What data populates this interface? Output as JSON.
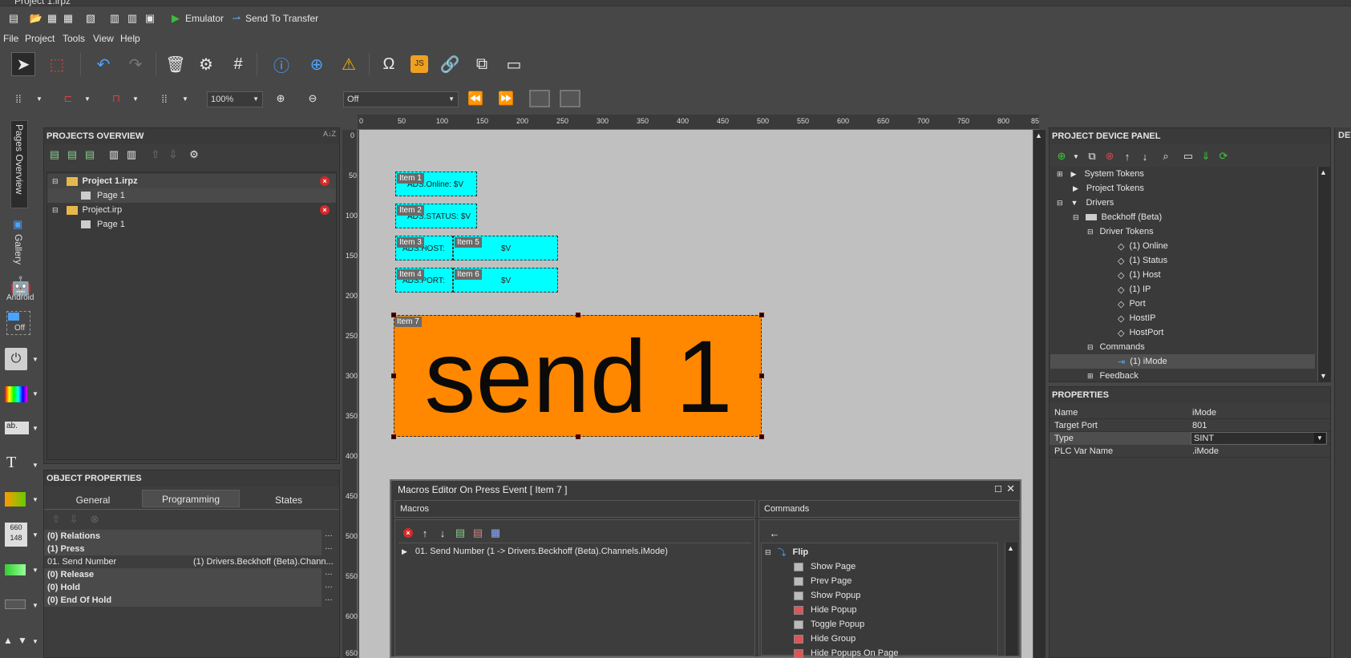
{
  "window": {
    "title": "Project 1.irpz"
  },
  "toolbar_top": {
    "emulator_label": "Emulator",
    "send_label": "Send To Transfer"
  },
  "menu": [
    "File",
    "Project",
    "Tools",
    "View",
    "Help"
  ],
  "toolbar_zoom": {
    "zoom": "100%",
    "layer": "Off"
  },
  "left_strip": {
    "pages_overview": "Pages Overview",
    "gallery": "Gallery",
    "android": "Android",
    "off": "Off"
  },
  "projects_overview": {
    "title": "PROJECTS OVERVIEW",
    "items": [
      {
        "label": "Project 1.irpz",
        "bold": true
      },
      {
        "label": "Page 1"
      },
      {
        "label": "Project.irp"
      },
      {
        "label": "Page 1"
      }
    ]
  },
  "object_properties": {
    "title": "OBJECT PROPERTIES",
    "tabs": [
      "General",
      "Programming",
      "States"
    ],
    "active_tab": "Programming",
    "rows": [
      {
        "label": "(0) Relations",
        "bold": true
      },
      {
        "label": "(1) Press",
        "bold": true
      },
      {
        "label": "01. Send Number",
        "value": "(1) Drivers.Beckhoff (Beta).Chann..."
      },
      {
        "label": "(0) Release",
        "bold": true
      },
      {
        "label": "(0) Hold",
        "bold": true
      },
      {
        "label": "(0) End Of Hold",
        "bold": true
      }
    ]
  },
  "ruler": {
    "h": [
      "0",
      "50",
      "100",
      "150",
      "200",
      "250",
      "300",
      "350",
      "400",
      "450",
      "500",
      "550",
      "600",
      "650",
      "700",
      "750",
      "800",
      "85"
    ],
    "v": [
      "0",
      "50",
      "100",
      "150",
      "200",
      "250",
      "300",
      "350",
      "400",
      "450",
      "500",
      "550",
      "600",
      "650"
    ]
  },
  "canvas": {
    "items": [
      {
        "tag": "Item 1",
        "text": "ADS.Online: $V"
      },
      {
        "tag": "Item 2",
        "text": "ADS.STATUS: $V"
      },
      {
        "tag": "Item 3",
        "text": "ADS.HOST:"
      },
      {
        "tag": "Item 5",
        "text": "$V"
      },
      {
        "tag": "Item 4",
        "text": "ADS.PORT:"
      },
      {
        "tag": "Item 6",
        "text": "$V"
      },
      {
        "tag": "Item 7",
        "text": "send 1"
      }
    ]
  },
  "macros_editor": {
    "title": "Macros Editor On Press Event [ Item 7 ]",
    "macros_header": "Macros",
    "commands_header": "Commands",
    "macro_rows": [
      "01. Send Number (1 -> Drivers.Beckhoff (Beta).Channels.iMode)"
    ],
    "commands_group": "Flip",
    "commands": [
      "Show Page",
      "Prev Page",
      "Show Popup",
      "Hide Popup",
      "Toggle Popup",
      "Hide Group",
      "Hide Popups On Page"
    ]
  },
  "device_panel": {
    "title": "PROJECT DEVICE PANEL",
    "tree": [
      {
        "label": "System Tokens",
        "level": 1
      },
      {
        "label": "Project Tokens",
        "level": 1
      },
      {
        "label": "Drivers",
        "level": 1
      },
      {
        "label": "Beckhoff (Beta)",
        "level": 2
      },
      {
        "label": "Driver Tokens",
        "level": 3
      },
      {
        "label": "(1) Online",
        "level": 4
      },
      {
        "label": "(1) Status",
        "level": 4
      },
      {
        "label": "(1) Host",
        "level": 4
      },
      {
        "label": "(1) IP",
        "level": 4
      },
      {
        "label": "Port",
        "level": 4
      },
      {
        "label": "HostIP",
        "level": 4
      },
      {
        "label": "HostPort",
        "level": 4
      },
      {
        "label": "Commands",
        "level": 3
      },
      {
        "label": "(1) iMode",
        "level": 4,
        "selected": true
      },
      {
        "label": "Feedback",
        "level": 3
      }
    ]
  },
  "properties": {
    "title": "PROPERTIES",
    "rows": [
      {
        "name": "Name",
        "value": "iMode"
      },
      {
        "name": "Target Port",
        "value": "801"
      },
      {
        "name": "Type",
        "value": "SINT"
      },
      {
        "name": "PLC Var Name",
        "value": ".iMode"
      }
    ]
  },
  "right_edge": {
    "label": "DEV"
  }
}
